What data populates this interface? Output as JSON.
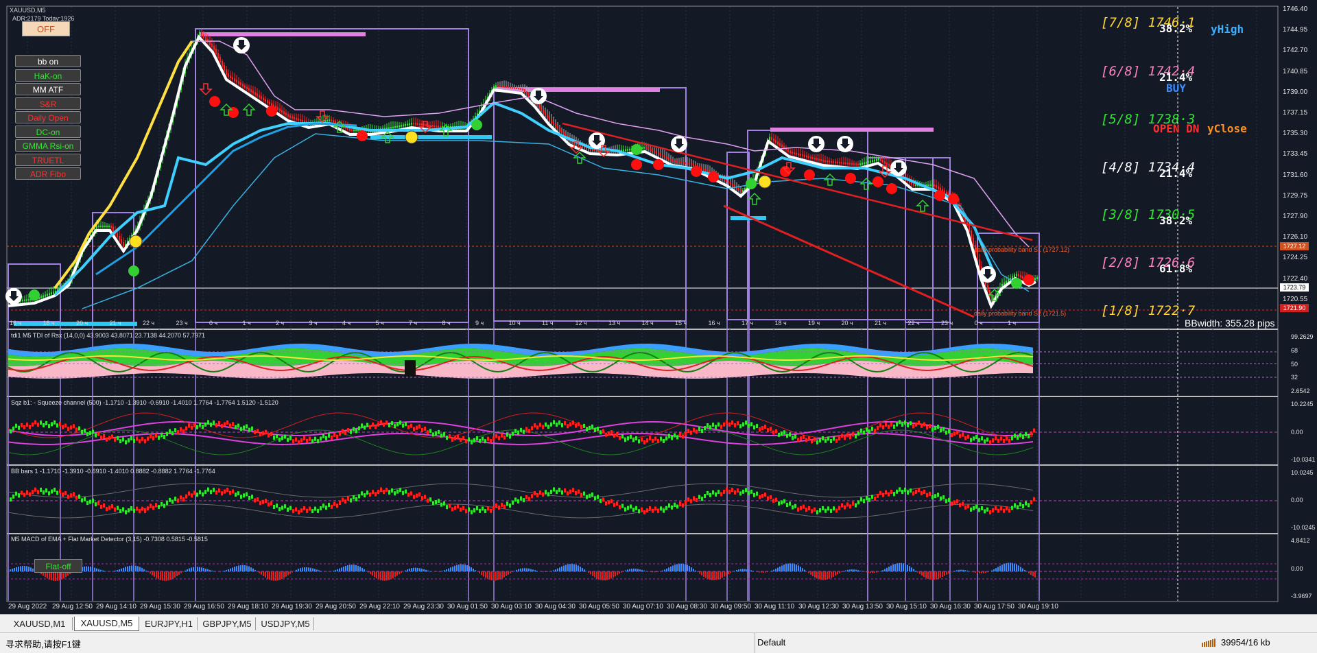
{
  "chart": {
    "symbol_title": "XAUUSD,M5",
    "adr_text": "ADR:2179 Today:1926",
    "off_button": "OFF",
    "buttons": [
      {
        "label": "bb on",
        "color": "#ffffff"
      },
      {
        "label": "HaK-on",
        "color": "#32e632"
      },
      {
        "label": "MM ATF",
        "color": "#ffffff"
      },
      {
        "label": "S&R",
        "color": "#ff3030"
      },
      {
        "label": "Daily Open",
        "color": "#ff3030"
      },
      {
        "label": "DC-on",
        "color": "#32e632"
      },
      {
        "label": "GMMA Rsi-on",
        "color": "#32e632"
      },
      {
        "label": "TRUETL",
        "color": "#ff3030"
      },
      {
        "label": "ADR Fibo",
        "color": "#ff3030"
      }
    ],
    "fibo_levels": [
      {
        "label": "[7/8]  1746·1",
        "color": "#ffd633",
        "pct": "38.2%"
      },
      {
        "label": "[6/8]  1742·4",
        "color": "#ff80c0",
        "pct": "21.4%"
      },
      {
        "label": "[5/8]  1738·3",
        "color": "#32e632",
        "pct": ""
      },
      {
        "label": "[4/8]  1734·4",
        "color": "#ffffff",
        "pct": "21.4%"
      },
      {
        "label": "[3/8]  1730·5",
        "color": "#32e632",
        "pct": "38.2%"
      },
      {
        "label": "[2/8]  1726·6",
        "color": "#ff80c0",
        "pct": "61.8%"
      },
      {
        "label": "[1/8]  1722·7",
        "color": "#ffd633",
        "pct": ""
      }
    ],
    "signals": {
      "yhigh": "yHigh",
      "buy": "BUY",
      "open_dn": "OPEN DN",
      "yclose": "yClose"
    },
    "band_label_s1": "daily probability band S1 (1727.12)",
    "band_label_s2": "daily probability band S2 (1721.5)",
    "bbwidth": "BBwidth: 355.28 pips",
    "price_axis": [
      "1746.40",
      "1744.95",
      "1742.70",
      "1740.85",
      "1739.00",
      "1737.15",
      "1735.30",
      "1733.45",
      "1731.60",
      "1729.75",
      "1727.90",
      "1726.10",
      "1724.25",
      "1722.40",
      "1720.55"
    ],
    "price_badges": [
      {
        "text": "1727.12",
        "bg": "#d05020"
      },
      {
        "text": "1723.79",
        "bg": "#ffffff"
      },
      {
        "text": "1721.90",
        "bg": "#d02020"
      }
    ],
    "hour_labels": [
      "16 ч",
      "18 ч",
      "20 ч",
      "21 ч",
      "22 ч",
      "23 ч",
      "0 ч",
      "1 ч",
      "2 ч",
      "3 ч",
      "4 ч",
      "5 ч",
      "7 ч",
      "8 ч",
      "9 ч",
      "10 ч",
      "11 ч",
      "12 ч",
      "13 ч",
      "14 ч",
      "15 ч",
      "16 ч",
      "17 ч",
      "18 ч",
      "19 ч",
      "20 ч",
      "21 ч",
      "22 ч",
      "23 ч",
      "0 ч",
      "1 ч"
    ],
    "sub_panels": [
      {
        "title": "tdi1 M5 TDI of Rsx (14,0,0) 43.9003 43.8071 23.7138 44.2070 57.7971",
        "ticks": [
          "99.2629",
          "68",
          "50",
          "32",
          "2.6542"
        ]
      },
      {
        "title": "Sqz b1: - Squeeze channel (500) -1.1710 -1.3910 -0.6910 -1.4010 1.7764 -1.7764 1.5120 -1.5120",
        "ticks": [
          "10.2245",
          "0.00",
          "-10.0341"
        ]
      },
      {
        "title": "BB bars 1 -1.1710 -1.3910 -0.6910 -1.4010 0.8882 -0.8882 1.7764 -1.7764",
        "ticks": [
          "10.0245",
          "0.00",
          "-10.0245"
        ]
      },
      {
        "title": "M5 MACD of EMA + Flat Market Detector (3,15) -0.7308 0.5815 -0.5815",
        "ticks": [
          "4.8412",
          "0.00",
          "-3.9697"
        ]
      }
    ],
    "flat_button": "Flat-off",
    "time_axis": [
      "29 Aug 2022",
      "29 Aug 12:50",
      "29 Aug 14:10",
      "29 Aug 15:30",
      "29 Aug 16:50",
      "29 Aug 18:10",
      "29 Aug 19:30",
      "29 Aug 20:50",
      "29 Aug 22:10",
      "29 Aug 23:30",
      "30 Aug 01:50",
      "30 Aug 03:10",
      "30 Aug 04:30",
      "30 Aug 05:50",
      "30 Aug 07:10",
      "30 Aug 08:30",
      "30 Aug 09:50",
      "30 Aug 11:10",
      "30 Aug 12:30",
      "30 Aug 13:50",
      "30 Aug 15:10",
      "30 Aug 16:30",
      "30 Aug 17:50",
      "30 Aug 19:10"
    ]
  },
  "tabs": [
    {
      "label": "XAUUSD,M1",
      "active": false
    },
    {
      "label": "XAUUSD,M5",
      "active": true
    },
    {
      "label": "EURJPY,H1",
      "active": false
    },
    {
      "label": "GBPJPY,M5",
      "active": false
    },
    {
      "label": "USDJPY,M5",
      "active": false
    }
  ],
  "status": {
    "help": "寻求帮助,请按F1键",
    "profile": "Default",
    "traffic": "39954/16 kb"
  },
  "colors": {
    "background": "#131a26",
    "bull": "#32e632",
    "bear": "#ff2020",
    "box": "#a080e0"
  }
}
